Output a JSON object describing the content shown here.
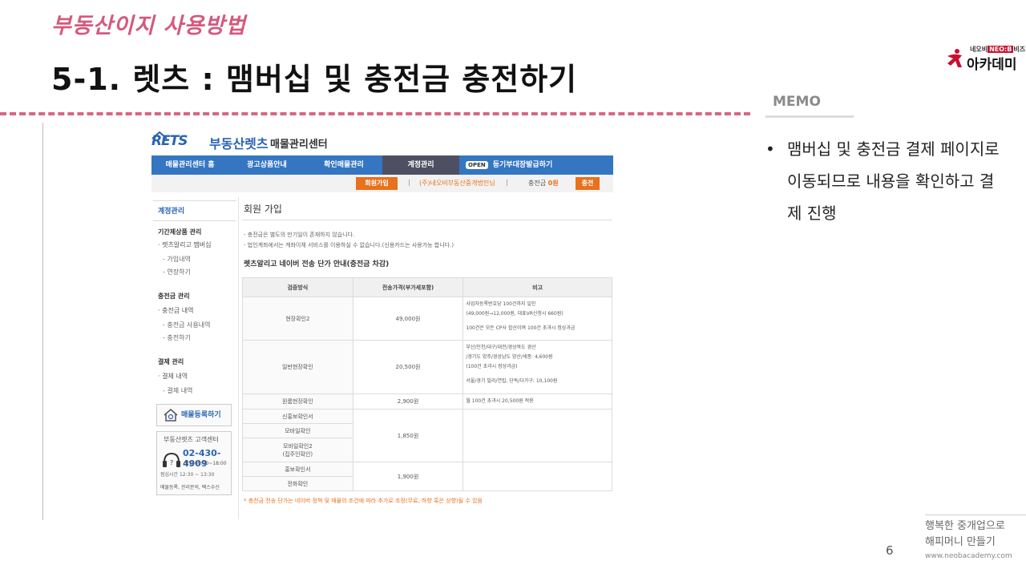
{
  "slide": {
    "subtitle": "부동산이지 사용방법",
    "title": "5-1. 렛츠 : 맴버십 및 충전금 충전하기",
    "page_number": "6",
    "colors": {
      "accent": "#d35a7e",
      "dash": "#d9667f"
    }
  },
  "logo": {
    "top_text_a": "네오비",
    "top_text_neo": "NEO:B",
    "top_text_b": "비즈",
    "main_text": "아카데미"
  },
  "memo": {
    "title": "MEMO",
    "bullet": "•",
    "text": "맴버십 및 충전금 결제 페이지로 이동되므로 내용을 확인하고 결제 진행"
  },
  "footer": {
    "line1": "행복한 중개업으로",
    "line2": "해피머니 만들기",
    "url": "www.neobacademy.com"
  },
  "screenshot": {
    "brand": {
      "logo": "RETS",
      "name": "부동산렛츠",
      "center": "매물관리센터"
    },
    "nav": [
      {
        "label": "매물관리센터 홈"
      },
      {
        "label": "광고상품안내"
      },
      {
        "label": "확인매물관리"
      },
      {
        "label": "계정관리"
      }
    ],
    "nav_open_badge": "OPEN",
    "nav_open_label": "등기부대장발급하기",
    "subbar": {
      "signup": "회원가입",
      "sep": "|",
      "company": "(주)네오비부동산중개법인님",
      "charge_label": "충전금",
      "charge_value": "0원",
      "charge_button": "충전"
    },
    "sidebar": {
      "head": "계정관리",
      "group1": "기간제상품 관리",
      "group1_item": "· 렛츠알리고 맴버십",
      "group1_sub1": "- 가입내역",
      "group1_sub2": "- 연장하기",
      "group2": "충전금 관리",
      "group2_item": "· 충전금 내역",
      "group2_sub1": "- 충전금 사용내역",
      "group2_sub2": "- 충전하기",
      "group3": "결제 관리",
      "group3_item": "· 결제 내역",
      "group3_sub1": "- 결제 내역",
      "register_button": "매물등록하기",
      "cs_title": "부동산렛츠 고객센터",
      "cs_phone": "02-430-4909",
      "cs_hours1": "평일 09:00~18:00",
      "cs_hours2": "점심시간 12:30 ~ 13:30",
      "cs_note": "매물등록, 관리문의, 팩스수신"
    },
    "content": {
      "title": "회원 가입",
      "notice1": "- 충전금은 별도의 만기일이 존재하지 않습니다.",
      "notice2": "- 법인계좌에서는 계좌이체 서비스를 이용하실 수 없습니다.(신용카드는 사용가능 합니다.)",
      "section_title": "렛츠알리고 네이버 전송 단가 안내(충전금 차감)",
      "headers": [
        "검증방식",
        "전송가격(부가세포함)",
        "비고"
      ],
      "rows": [
        {
          "method": "현장확인2",
          "price": "49,000원",
          "note1": "사업자등록번호당 100건까지 일인",
          "note2": "(49,000원→12,000원, 대표VR신청시 660원)",
          "note3": "100건은 모든 CP사 합산이며 100건 초과시 정상과금"
        },
        {
          "method": "일반현장확인",
          "price": "20,500원",
          "note1": "부산/인천/대구/대전/경상북도 경산",
          "note2": "/경기도 양주/경상남도 양산/세종: 4,600원",
          "note3": "(100건 초과시 정상과금)",
          "note4": "서울/경기 빌라/연립, 단독/다가구: 10,100원"
        },
        {
          "method": "원룸현장확인",
          "price": "2,900원",
          "note1": "월 100건 초과시 20,500원 적용"
        },
        {
          "method": "신홍보확인서"
        },
        {
          "method": "모바일확인",
          "price": "1,850원"
        },
        {
          "method": "모바일확인2\n(집주인확인)"
        },
        {
          "method": "홍보확인서"
        },
        {
          "method": "전화확인",
          "price": "1,900원"
        }
      ],
      "footnote": "* 충전금 전송 단가는 네이버 정책 및 매물의 조건에 따라 추가로 조정(무료, 하향 혹은 상향)될 수 있음"
    }
  }
}
